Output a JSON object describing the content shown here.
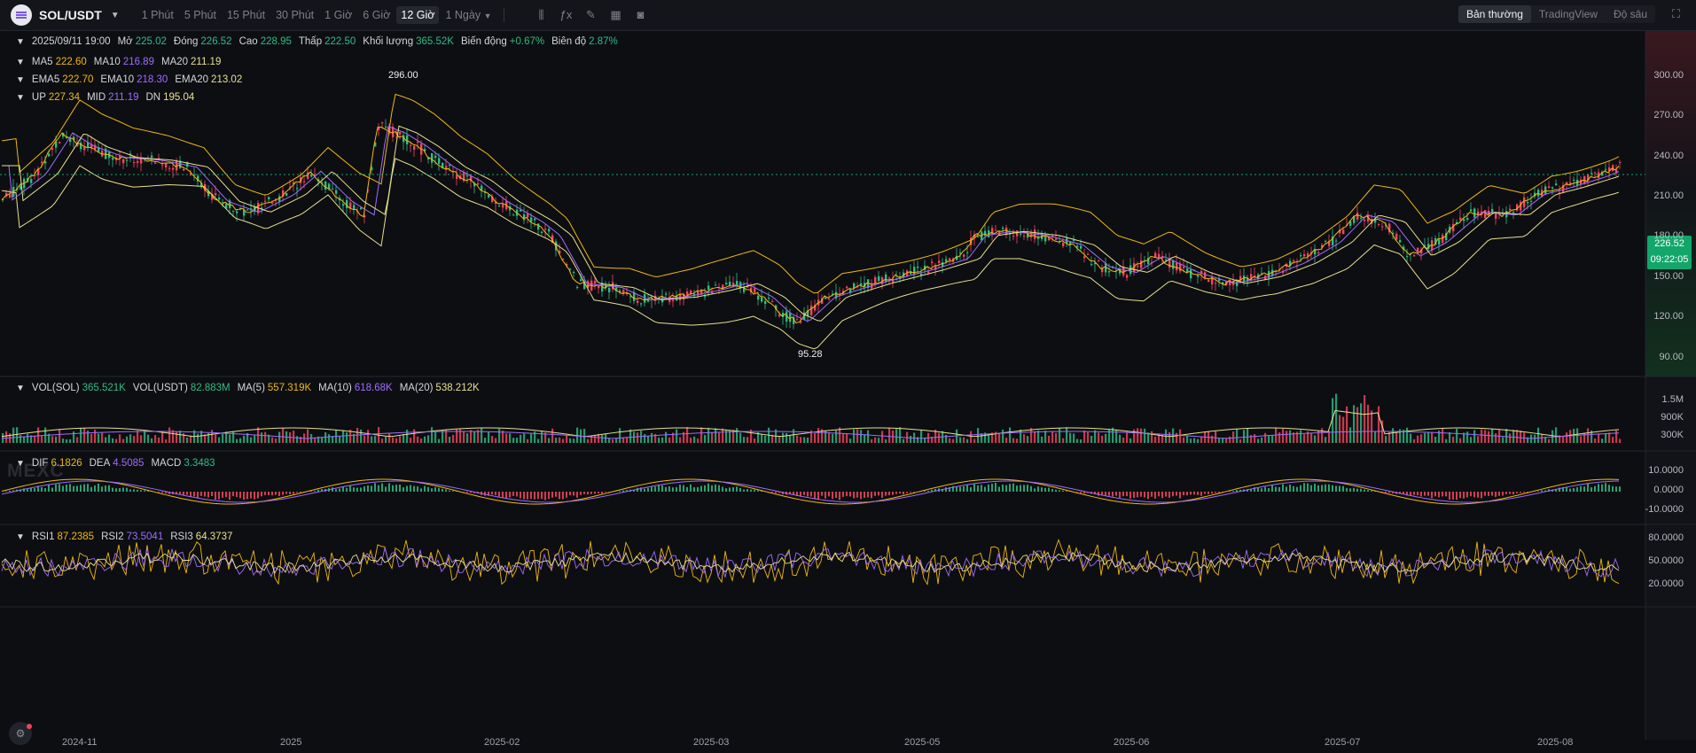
{
  "header": {
    "pair": "SOL/USDT",
    "intervals": [
      "1 Phút",
      "5 Phút",
      "15 Phút",
      "30 Phút",
      "1 Giờ",
      "6 Giờ",
      "12 Giờ"
    ],
    "interval_more": "1 Ngày",
    "modes": [
      "Bản thường",
      "TradingView",
      "Độ sâu"
    ]
  },
  "ohlc": {
    "date": "2025/09/11 19:00",
    "open_label": "Mở",
    "open": "225.02",
    "close_label": "Đóng",
    "close": "226.52",
    "high_label": "Cao",
    "high": "228.95",
    "low_label": "Thấp",
    "low": "222.50",
    "volume_label": "Khối lượng",
    "volume": "365.52K",
    "change_label": "Biến động",
    "change": "+0.67%",
    "amplitude_label": "Biên độ",
    "amplitude": "2.87%"
  },
  "ma": {
    "ma5_label": "MA5",
    "ma5": "222.60",
    "ma10_label": "MA10",
    "ma10": "216.89",
    "ma20_label": "MA20",
    "ma20": "211.19"
  },
  "ema": {
    "ema5_label": "EMA5",
    "ema5": "222.70",
    "ema10_label": "EMA10",
    "ema10": "218.30",
    "ema20_label": "EMA20",
    "ema20": "213.02"
  },
  "boll": {
    "up_label": "UP",
    "up": "227.34",
    "mid_label": "MID",
    "mid": "211.19",
    "dn_label": "DN",
    "dn": "195.04"
  },
  "vol": {
    "sol_label": "VOL(SOL)",
    "sol": "365.521K",
    "usdt_label": "VOL(USDT)",
    "usdt": "82.883M",
    "ma5_label": "MA(5)",
    "ma5": "557.319K",
    "ma10_label": "MA(10)",
    "ma10": "618.68K",
    "ma20_label": "MA(20)",
    "ma20": "538.212K"
  },
  "macd": {
    "dif_label": "DIF",
    "dif": "6.1826",
    "dea_label": "DEA",
    "dea": "4.5085",
    "macd_label": "MACD",
    "macd": "3.3483"
  },
  "rsi": {
    "rsi1_label": "RSI1",
    "rsi1": "87.2385",
    "rsi2_label": "RSI2",
    "rsi2": "73.5041",
    "rsi3_label": "RSI3",
    "rsi3": "64.3737"
  },
  "price_axis": [
    "300.00",
    "270.00",
    "240.00",
    "210.00",
    "180.00",
    "150.00",
    "120.00",
    "90.00"
  ],
  "vol_axis": [
    "1.5M",
    "900K",
    "300K"
  ],
  "macd_axis": [
    "10.0000",
    "0.0000",
    "-10.0000"
  ],
  "rsi_axis": [
    "80.0000",
    "50.0000",
    "20.0000"
  ],
  "time_axis": [
    "2024-11",
    "2025",
    "2025-02",
    "2025-03",
    "2025-05",
    "2025-06",
    "2025-07",
    "2025-08"
  ],
  "current_price": "226.52",
  "countdown": "09:22:05",
  "high_marker": "296.00",
  "low_marker": "95.28",
  "watermark": "MEXC",
  "colors": {
    "up": "#2ebd85",
    "down": "#f6465d",
    "ma5": "#f0b90b",
    "ma10": "#9f6bff",
    "ma20": "#e7e08d",
    "accent": "#13a66b"
  }
}
